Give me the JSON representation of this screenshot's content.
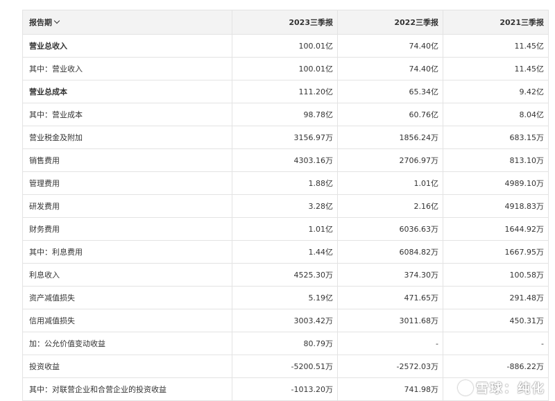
{
  "table": {
    "header": {
      "period_label": "报告期",
      "columns": [
        "2023三季报",
        "2022三季报",
        "2021三季报"
      ]
    },
    "rows": [
      {
        "label": "营业总收入",
        "bold": true,
        "values": [
          "100.01亿",
          "74.40亿",
          "11.45亿"
        ]
      },
      {
        "label": "其中：营业收入",
        "bold": false,
        "values": [
          "100.01亿",
          "74.40亿",
          "11.45亿"
        ]
      },
      {
        "label": "营业总成本",
        "bold": true,
        "values": [
          "111.20亿",
          "65.34亿",
          "9.42亿"
        ]
      },
      {
        "label": "其中：营业成本",
        "bold": false,
        "values": [
          "98.78亿",
          "60.76亿",
          "8.04亿"
        ]
      },
      {
        "label": "营业税金及附加",
        "bold": false,
        "values": [
          "3156.97万",
          "1856.24万",
          "683.15万"
        ]
      },
      {
        "label": "销售费用",
        "bold": false,
        "values": [
          "4303.16万",
          "2706.97万",
          "813.10万"
        ]
      },
      {
        "label": "管理费用",
        "bold": false,
        "values": [
          "1.88亿",
          "1.01亿",
          "4989.10万"
        ]
      },
      {
        "label": "研发费用",
        "bold": false,
        "values": [
          "3.28亿",
          "2.16亿",
          "4918.83万"
        ]
      },
      {
        "label": "财务费用",
        "bold": false,
        "values": [
          "1.01亿",
          "6036.63万",
          "1644.92万"
        ]
      },
      {
        "label": "其中：利息费用",
        "bold": false,
        "values": [
          "1.44亿",
          "6084.82万",
          "1667.95万"
        ]
      },
      {
        "label": "利息收入",
        "bold": false,
        "values": [
          "4525.30万",
          "374.30万",
          "100.58万"
        ]
      },
      {
        "label": "资产减值损失",
        "bold": false,
        "values": [
          "5.19亿",
          "471.65万",
          "291.48万"
        ]
      },
      {
        "label": "信用减值损失",
        "bold": false,
        "values": [
          "3003.42万",
          "3011.68万",
          "450.31万"
        ]
      },
      {
        "label": "加：公允价值变动收益",
        "bold": false,
        "values": [
          "80.79万",
          "-",
          "-"
        ]
      },
      {
        "label": "投资收益",
        "bold": false,
        "values": [
          "-5200.51万",
          "-2572.03万",
          "-886.22万"
        ]
      },
      {
        "label": "其中：对联营企业和合营企业的投资收益",
        "bold": false,
        "values": [
          "-1013.20万",
          "741.98万",
          ""
        ]
      }
    ]
  },
  "watermark": {
    "text": "雪球：纯化"
  }
}
